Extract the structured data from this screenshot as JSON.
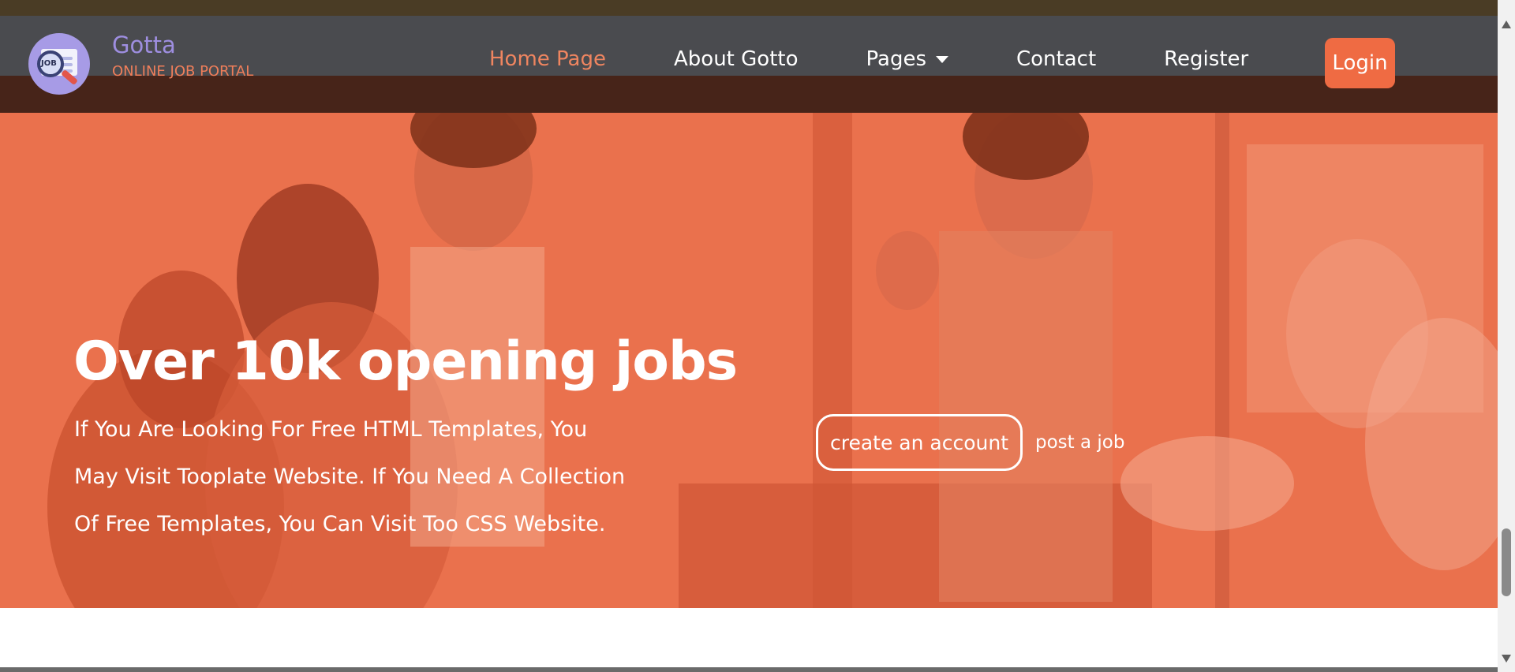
{
  "brand": {
    "name": "Gotta",
    "tagline": "ONLINE JOB PORTAL",
    "logo_text": "JOB"
  },
  "nav": {
    "items": [
      {
        "label": "Home Page",
        "active": true
      },
      {
        "label": "About Gotto",
        "active": false
      },
      {
        "label": "Pages",
        "active": false,
        "dropdown": true
      },
      {
        "label": "Contact",
        "active": false
      },
      {
        "label": "Register",
        "active": false
      }
    ],
    "login_label": "Login"
  },
  "hero": {
    "title": "Over 10k opening jobs",
    "description": "If You Are Looking For Free HTML Templates, You May Visit Tooplate Website. If You Need A Collection Of Free Templates, You Can Visit Too CSS Website.",
    "primary_button": "create an account",
    "secondary_link": "post a job"
  },
  "colors": {
    "accent": "#ef6b43",
    "overlay": "#e96e4b",
    "brand_name": "#9e8ee0",
    "nav_bg": "#4a4b4f"
  }
}
